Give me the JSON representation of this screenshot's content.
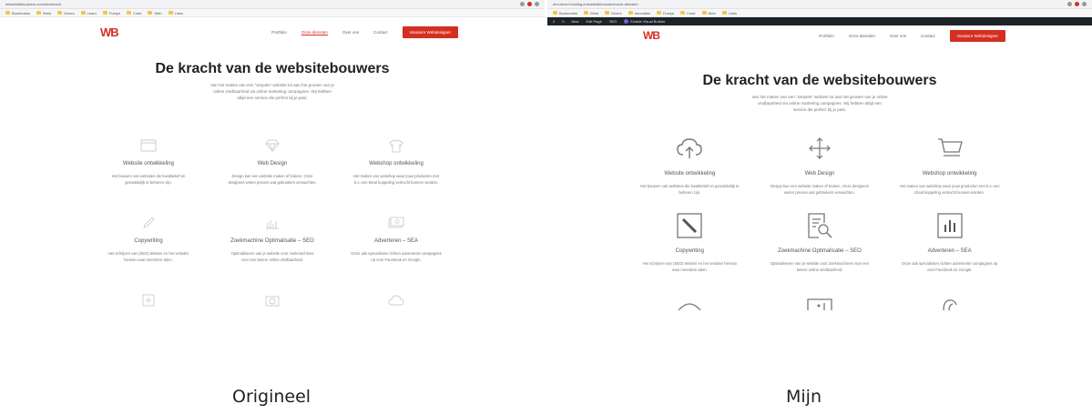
{
  "captions": {
    "left": "Origineel",
    "right": "Mijn"
  },
  "colors": {
    "brand": "#d52f22",
    "wp_bar": "#1d2327",
    "heading": "#222222",
    "muted": "#777777"
  },
  "left": {
    "url": "dewebsitebouwers.com/services/#",
    "bookmarks": [
      "Bookmarks",
      "Werk",
      "Divers",
      "Learn",
      "Fuelya",
      "Code",
      "Web",
      "Links"
    ],
    "nav": {
      "logo": "WB",
      "items": [
        "Portfolio",
        "Onze diensten",
        "Over ons",
        "Contact"
      ],
      "active_index": 1,
      "cta": "Vacature Webdesigner"
    },
    "hero": {
      "title": "De kracht van de websitebouwers",
      "text": "Van het maken van een \"simpele\" website tot aan het groeien van je online vindbaarheid via online marketing campagnes. Wij hebben altijd een service die perfect bij je past."
    },
    "services": [
      {
        "icon": "browser-window-icon",
        "title": "Website ontwikkeling",
        "text": "Het bouwen van websites die kwaliteitief en gemakkelijk te beheren zijn."
      },
      {
        "icon": "diamond-icon",
        "title": "Web Design",
        "text": "Design kan een website maken of kraken. Onze designers weten precies wat gebruikers verwachten."
      },
      {
        "icon": "tshirt-icon",
        "title": "Webshop ontwikkeling",
        "text": "Het maken van webshop waar jouw producten met b.v. een iDeal koppeling verkocht kunnen worden."
      },
      {
        "icon": "pencil-icon",
        "title": "Copywriting",
        "text": "Het schrijven van (SEO) teksten en het vertalen hiervan naar meerdere talen."
      },
      {
        "icon": "bar-chart-icon",
        "title": "Zoekmachine Optimalisatie – SEO",
        "text": "Optimaliseren van je website voor zoekmachines voor een betere online vindbaarheid."
      },
      {
        "icon": "money-icon",
        "title": "Adverteren – SEA",
        "text": "Onze ads specialisten richten advertentie campagnes op voor Facebook en Google."
      },
      {
        "icon": "plus-box-icon",
        "title": "",
        "text": ""
      },
      {
        "icon": "camera-icon",
        "title": "",
        "text": ""
      },
      {
        "icon": "cloud-icon",
        "title": "",
        "text": ""
      }
    ]
  },
  "right": {
    "url": "dev.clever-hosting.eu/websitebouwers/onze-diensten",
    "bookmarks": [
      "Bookmarks",
      "Werk",
      "Divers",
      "Aanvalles",
      "Fuelya",
      "Code",
      "Web",
      "Links"
    ],
    "wp_bar": [
      "2",
      "0",
      "New",
      "Edit Page",
      "SEO",
      "Enable Visual Builder"
    ],
    "nav": {
      "logo": "WB",
      "items": [
        "Portfolio",
        "Onze diensten",
        "Over ons",
        "Contact"
      ],
      "active_index": -1,
      "cta": "Vacature Webdesigner"
    },
    "hero": {
      "title": "De kracht van de websitebouwers",
      "text": "Van het maken van een \"simpele\" website tot aan het groeien van je online vindbaarheid via online marketing campagnes. Wij hebben altijd een service die perfect bij je past."
    },
    "services": [
      {
        "icon": "cloud-upload-icon",
        "title": "Website ontwikkeling",
        "text": "Het bouwen van websites die kwaliteitief en gemakkelijk te beheren zijn."
      },
      {
        "icon": "move-arrows-icon",
        "title": "Web Design",
        "text": "Design kan een website maken of kraken. Onze designers weten precies wat gebruikers verwachten."
      },
      {
        "icon": "shopping-cart-icon",
        "title": "Webshop ontwikkeling",
        "text": "Het maken van webshop waar jouw producten met b.v. een iDeal koppeling verkocht kunnen worden."
      },
      {
        "icon": "pencil-box-icon",
        "title": "Copywriting",
        "text": "Het schrijven van (SEO) teksten en het vertalen hiervan naar meerdere talen."
      },
      {
        "icon": "document-search-icon",
        "title": "Zoekmachine Optimalisatie – SEO",
        "text": "Optimaliseren van je website voor zoekmachines voor een betere online vindbaarheid."
      },
      {
        "icon": "bar-chart-box-icon",
        "title": "Adverteren – SEA",
        "text": "Onze ads specialisten richten advertentie campagnes op voor Facebook en Google."
      }
    ]
  }
}
